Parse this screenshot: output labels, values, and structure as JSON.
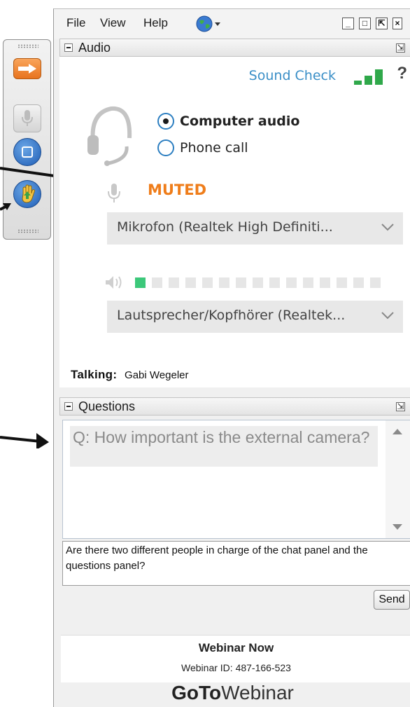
{
  "menu": {
    "file": "File",
    "view": "View",
    "help": "Help"
  },
  "window_controls": {
    "minimize": "_",
    "maximize": "□",
    "popout": "⇱",
    "close": "×"
  },
  "audio": {
    "title": "Audio",
    "sound_check": "Sound Check",
    "help": "?",
    "options": [
      "Computer audio",
      "Phone call"
    ],
    "selected_option": "Computer audio",
    "mic_status": "MUTED",
    "microphone": "Mikrofon (Realtek High Definiti...",
    "speaker": "Lautsprecher/Kopfhörer (Realtek...",
    "vu_level": 0.08,
    "talking_label": "Talking:",
    "talking_name": "Gabi Wegeler"
  },
  "questions": {
    "title": "Questions",
    "items": [
      "Q: How important is the external camera?"
    ],
    "input_value": "Are there two different people in charge of the chat panel and the questions panel?",
    "send_label": "Send"
  },
  "footer": {
    "title": "Webinar Now",
    "webinar_id": "Webinar ID: 487-166-523",
    "brand_bold": "GoTo",
    "brand_light": "Webinar"
  },
  "colors": {
    "accent_blue": "#3b8fc7",
    "muted_orange": "#ef7d1a",
    "level_green": "#3cc87a",
    "signal_green": "#2fa84a"
  }
}
